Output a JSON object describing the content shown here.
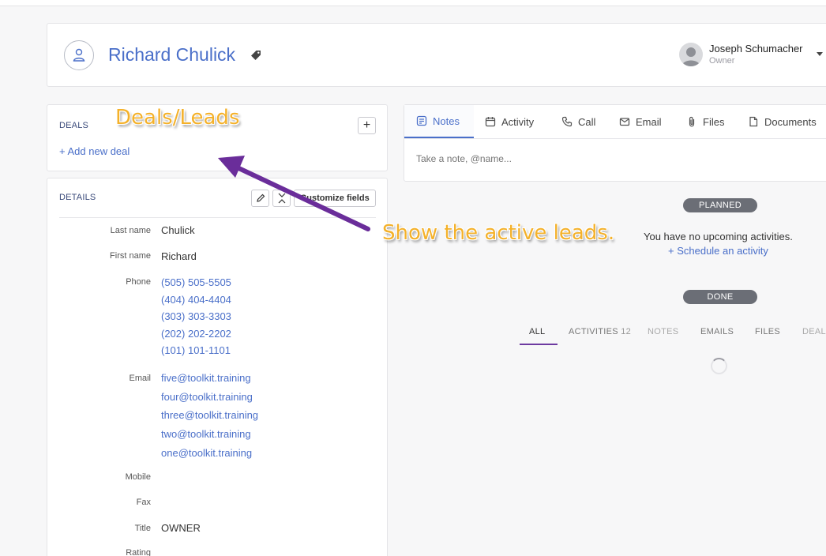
{
  "header": {
    "contact_name": "Richard Chulick",
    "owner_name": "Joseph Schumacher",
    "owner_role": "Owner"
  },
  "deals": {
    "title": "DEALS",
    "add_label": "+ Add new deal",
    "plus_label": "+"
  },
  "details": {
    "title": "DETAILS",
    "customize_label": "Customize fields",
    "fields": {
      "last_name_label": "Last name",
      "last_name_value": "Chulick",
      "first_name_label": "First name",
      "first_name_value": "Richard",
      "phone_label": "Phone",
      "phones": [
        "(505) 505-5505",
        "(404) 404-4404",
        "(303) 303-3303",
        "(202) 202-2202",
        "(101) 101-1101"
      ],
      "email_label": "Email",
      "emails": [
        "five@toolkit.training",
        "four@toolkit.training",
        "three@toolkit.training",
        "two@toolkit.training",
        "one@toolkit.training"
      ],
      "mobile_label": "Mobile",
      "fax_label": "Fax",
      "title_label": "Title",
      "title_value": "OWNER",
      "rating_label": "Rating"
    }
  },
  "tabs": {
    "items": [
      "Notes",
      "Activity",
      "Call",
      "Email",
      "Files",
      "Documents"
    ],
    "active": "Notes"
  },
  "note": {
    "placeholder": "Take a note, @name..."
  },
  "timeline": {
    "planned_label": "PLANNED",
    "no_activities": "You have no upcoming activities.",
    "schedule_link": "+ Schedule an activity",
    "done_label": "DONE",
    "filters": {
      "all": "ALL",
      "activities": "ACTIVITIES",
      "activities_count": "12",
      "notes": "NOTES",
      "emails": "EMAILS",
      "files": "FILES",
      "deals": "DEALS"
    }
  },
  "annotations": {
    "deals_leads": "Deals/Leads",
    "show_active": "Show the active leads."
  },
  "colors": {
    "link": "#4a6fc9",
    "annotation": "#f4b12a",
    "arrow": "#6a2d9a",
    "pill": "#6b6e76"
  }
}
